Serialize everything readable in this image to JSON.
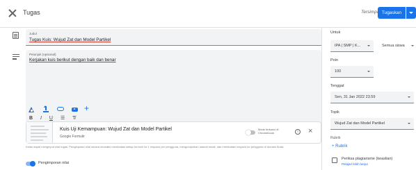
{
  "header": {
    "title": "Tugas",
    "save_label": "Tersimpan",
    "assign_label": "Tugaskan"
  },
  "main": {
    "title_field": {
      "label": "Judul",
      "value": "Tugas Kuis: Wujud Zat dan Model Partikel"
    },
    "instructions_field": {
      "label": "Petunjuk (opsional)",
      "value": "Kerjakan kuis berikut dengan baik dan benar"
    },
    "format_bar": {
      "bold": "B",
      "italic": "I",
      "underline": "U",
      "list": "☰",
      "clear": "T̸"
    },
    "attachment": {
      "title": "Kuis Uji Kemampuan: Wujud Zat dan Model Partikel",
      "subtitle": "Google Formulir",
      "toggle_label": "Mode terkunci di Chromebook",
      "info": "i",
      "remove": "×"
    },
    "notice": "Kelas dapat menginput nilai tugas. Penginputan nilai secara otomatis membatasi setiap formulir ke 1 respons per pengguna, mengumpulkan alamat email, dan membatasi respons ke pengguna di domain Anda.",
    "grading_label": "Pengimporan nilai"
  },
  "sidebar": {
    "for_label": "Untuk",
    "class_value": "IPA | SMP | K...",
    "students_value": "Semua siswa",
    "points_label": "Poin",
    "points_value": "100",
    "due_label": "Tenggat",
    "due_value": "Sen, 31 Jan 2022 23.59",
    "topic_label": "Topik",
    "topic_value": "Wujud Zat dan Model Partikel",
    "rubric_label": "Rubrik",
    "rubric_button": "+ Rubrik",
    "plagiarism_label": "Periksa plagiarisme (keaslian)",
    "plagiarism_sub": "Pelajari lebih lanjut"
  },
  "colors": {
    "accent": "#1a73e8",
    "field_bg": "#f1f3f4",
    "underline_error": "#d93025"
  }
}
